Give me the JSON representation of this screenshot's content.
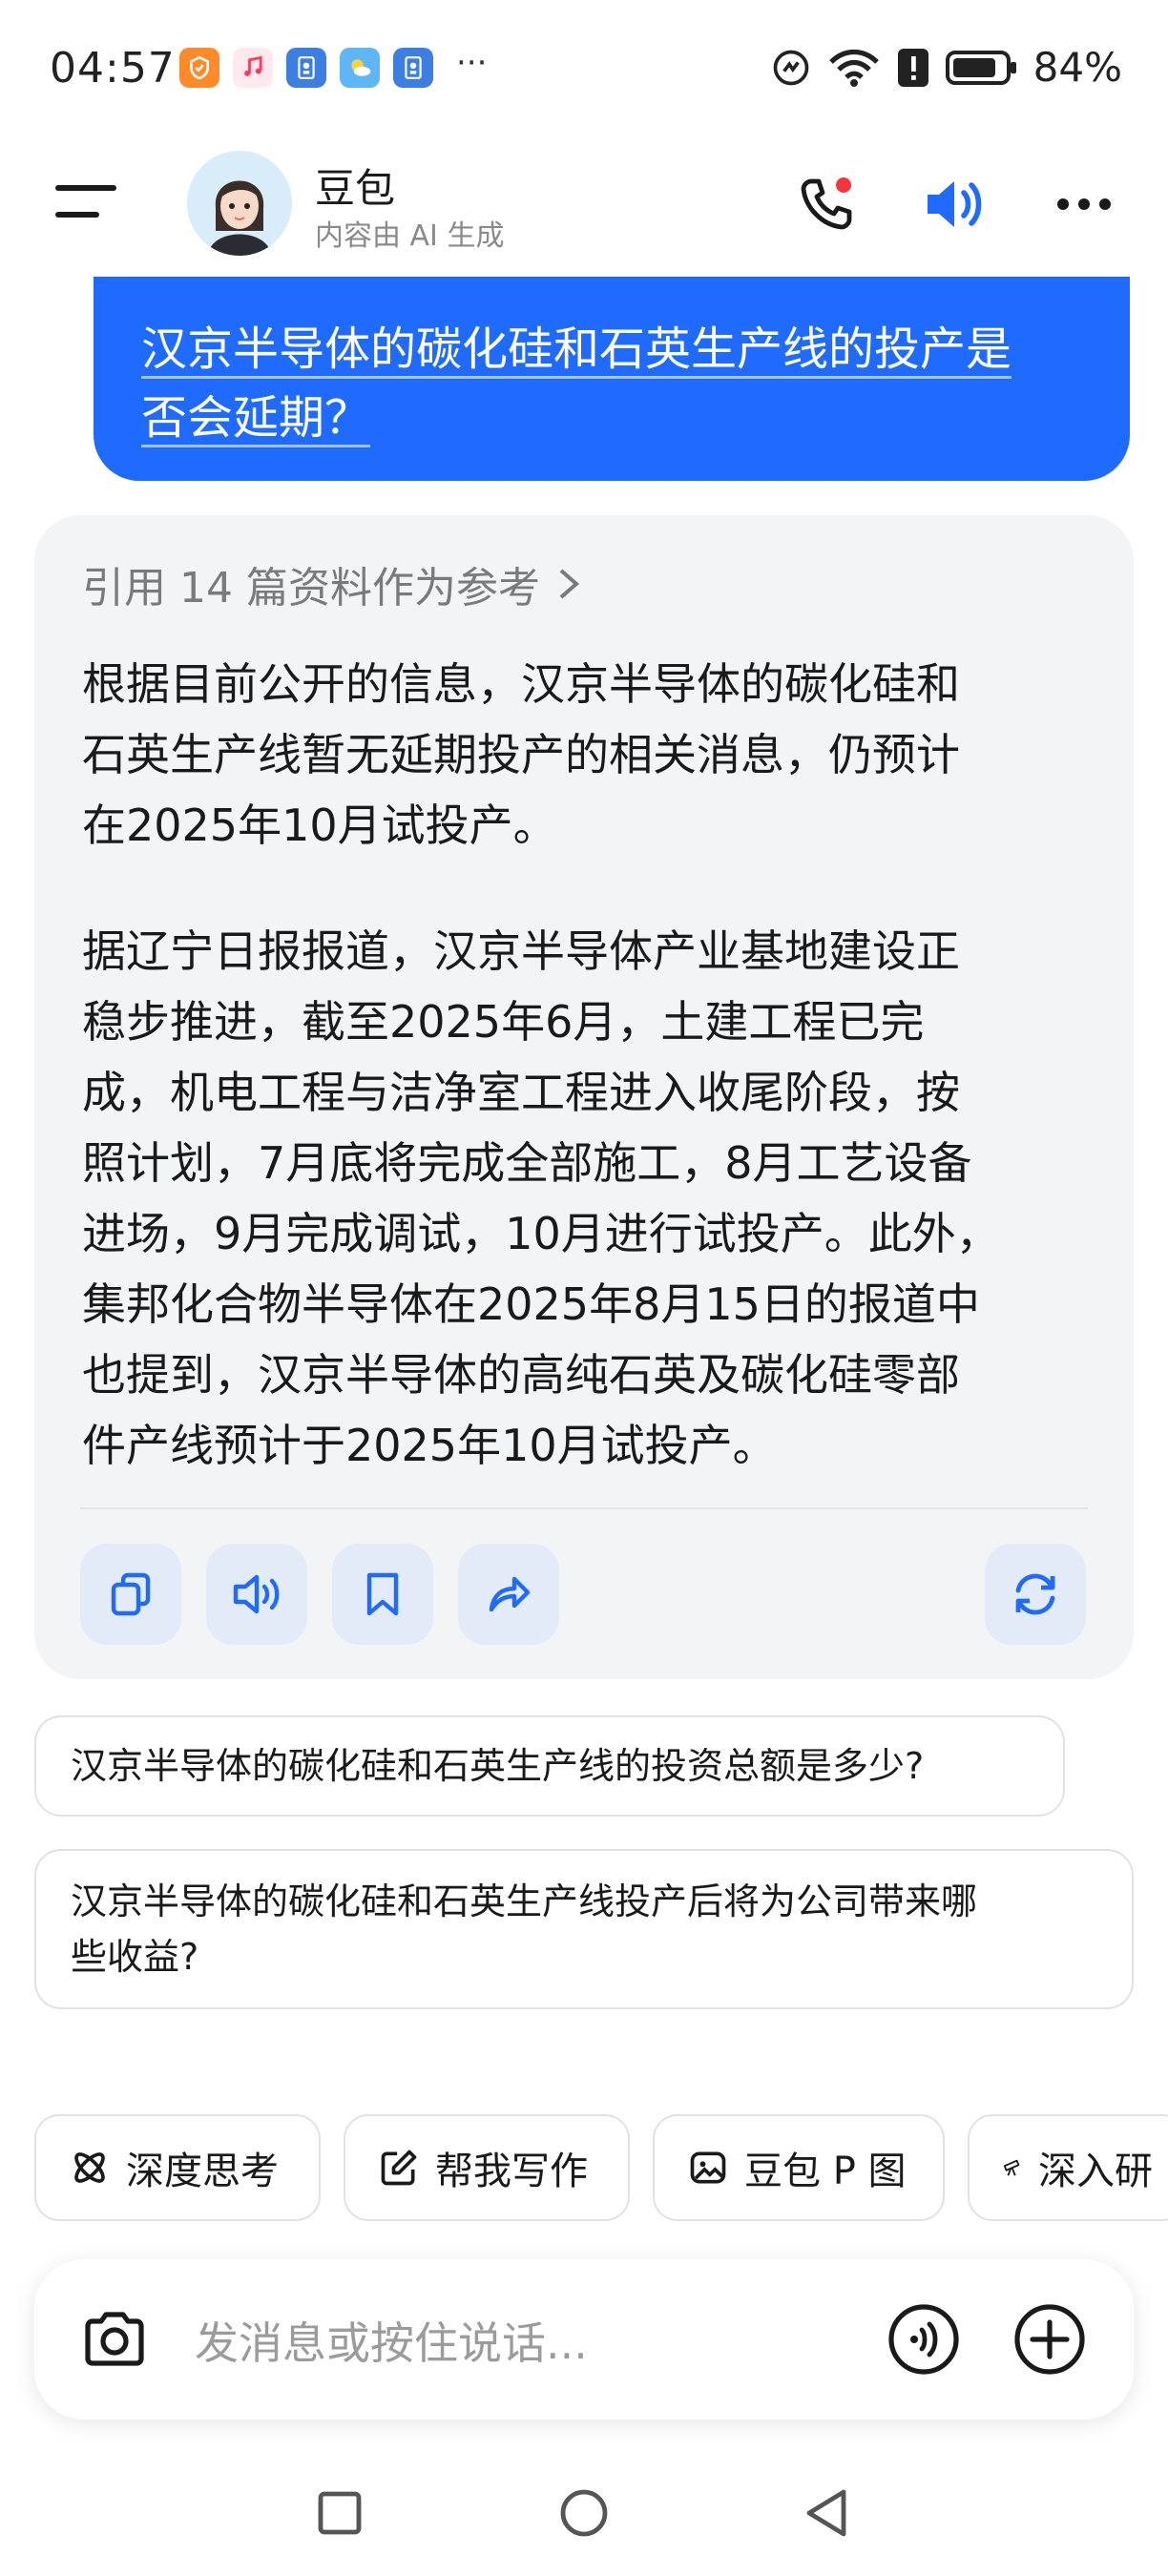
{
  "status_bar": {
    "time": "04:57",
    "more": "···",
    "battery": "84%"
  },
  "header": {
    "name": "豆包",
    "subtitle": "内容由 AI 生成"
  },
  "user_message": {
    "line1": "汉京半导体的碳化硅和石英生产线的投产是",
    "line2": "否会延期？"
  },
  "answer": {
    "reference": "引用 14 篇资料作为参考",
    "p1_lines": [
      "根据目前公开的信息，汉京半导体的碳化硅和",
      "石英生产线暂无延期投产的相关消息，仍预计",
      "在2025年10月试投产。"
    ],
    "p2_lines": [
      "据辽宁日报报道，汉京半导体产业基地建设正",
      "稳步推进，截至2025年6月，土建工程已完",
      "成，机电工程与洁净室工程进入收尾阶段，按",
      "照计划，7月底将完成全部施工，8月工艺设备",
      "进场，9月完成调试，10月进行试投产。此外，",
      "集邦化合物半导体在2025年8月15日的报道中",
      "也提到，汉京半导体的高纯石英及碳化硅零部",
      "件产线预计于2025年10月试投产。"
    ]
  },
  "suggestions": [
    {
      "line1": "汉京半导体的碳化硅和石英生产线的投资总额是多少?",
      "line2": ""
    },
    {
      "line1": "汉京半导体的碳化硅和石英生产线投产后将为公司带来哪",
      "line2": "些收益?"
    }
  ],
  "tools": [
    {
      "label": "深度思考",
      "icon": "atom-icon"
    },
    {
      "label": "帮我写作",
      "icon": "edit-icon"
    },
    {
      "label": "豆包 P 图",
      "icon": "image-edit-icon"
    },
    {
      "label": "深入研",
      "icon": "telescope-icon"
    }
  ],
  "input": {
    "placeholder": "发消息或按住说话..."
  },
  "colors": {
    "accent": "#1f6bff",
    "card_bg": "#f3f4f6",
    "action_bg": "#e4ebf8",
    "notification_dot": "#f5343d"
  }
}
